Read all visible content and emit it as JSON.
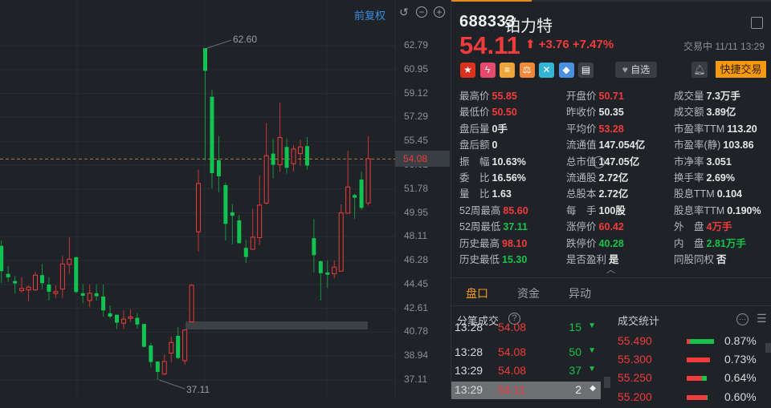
{
  "chart": {
    "toolbar": {
      "adjust_label": "前复权",
      "undo_icon": "undo-icon",
      "zoom_out_icon": "minus-circle-icon",
      "zoom_in_icon": "plus-circle-icon"
    },
    "current_price_label": "54.08",
    "high_marker": "62.60",
    "low_marker": "37.11"
  },
  "chart_data": {
    "type": "candlestick",
    "y_ticks": [
      "62.79",
      "60.95",
      "59.12",
      "57.29",
      "55.45",
      "53.62",
      "51.78",
      "49.95",
      "48.11",
      "46.28",
      "44.45",
      "42.61",
      "40.78",
      "38.94",
      "37.11"
    ],
    "ylim": [
      37.11,
      62.79
    ],
    "current_price": 54.08,
    "up_color": "#f03c3c",
    "down_color": "#11c452",
    "candles": [
      [
        47.42,
        45.47,
        47.83,
        44.55
      ],
      [
        45.26,
        45.0,
        45.88,
        44.65
      ],
      [
        44.71,
        44.53,
        45.1,
        43.73
      ],
      [
        43.97,
        44.14,
        45.0,
        43.83
      ],
      [
        44.03,
        44.24,
        44.38,
        43.17
      ],
      [
        44.03,
        45.16,
        45.43,
        43.97
      ],
      [
        45.16,
        44.55,
        46.02,
        44.09
      ],
      [
        44.44,
        43.89,
        45.0,
        43.21
      ],
      [
        43.75,
        43.89,
        44.38,
        43.42
      ],
      [
        44.09,
        46.02,
        46.64,
        43.42
      ],
      [
        45.98,
        46.39,
        48.08,
        45.26
      ],
      [
        46.54,
        43.87,
        46.6,
        43.77
      ],
      [
        43.77,
        43.58,
        44.48,
        43.01
      ],
      [
        43.21,
        43.77,
        44.44,
        42.7
      ],
      [
        43.77,
        43.54,
        44.44,
        43.21
      ],
      [
        43.52,
        42.45,
        44.44,
        41.98
      ],
      [
        42.23,
        41.98,
        42.84,
        41.84
      ],
      [
        42.12,
        41.51,
        42.12,
        41.02
      ],
      [
        41.47,
        41.78,
        42.45,
        41.02
      ],
      [
        41.84,
        41.96,
        42.54,
        41.57
      ],
      [
        41.88,
        41.37,
        42.23,
        41.06
      ],
      [
        41.41,
        39.66,
        41.41,
        39.62
      ],
      [
        39.76,
        38.49,
        39.97,
        38.08
      ],
      [
        38.53,
        37.73,
        38.53,
        37.11
      ],
      [
        37.57,
        38.53,
        39.07,
        37.47
      ],
      [
        39.17,
        39.99,
        40.44,
        38.49
      ],
      [
        40.5,
        38.8,
        41.16,
        38.7
      ],
      [
        38.59,
        40.95,
        40.95,
        38.29
      ],
      [
        41.57,
        44.38,
        44.48,
        41.53
      ],
      [
        48.49,
        52.2,
        53.27,
        46.97
      ],
      [
        62.6,
        60.86,
        62.6,
        53.99
      ],
      [
        58.87,
        53.0,
        59.43,
        51.83
      ],
      [
        53.99,
        52.76,
        55.84,
        51.53
      ],
      [
        52.08,
        49.1,
        52.28,
        47.83
      ],
      [
        49.99,
        49.72,
        50.64,
        47.52
      ],
      [
        49.37,
        47.62,
        49.78,
        47.58
      ],
      [
        47.26,
        46.56,
        47.87,
        46.09
      ],
      [
        47.15,
        48.08,
        50.25,
        47.11
      ],
      [
        48.04,
        50.54,
        52.8,
        47.46
      ],
      [
        50.7,
        54.34,
        56.86,
        50.6
      ],
      [
        54.5,
        53.64,
        55.63,
        52.59
      ],
      [
        53.64,
        55.73,
        58.4,
        53.11
      ],
      [
        55.01,
        53.41,
        55.67,
        52.96
      ],
      [
        53.72,
        54.85,
        55.16,
        53.13
      ],
      [
        54.5,
        55.01,
        55.57,
        53.58
      ],
      [
        55.08,
        53.58,
        55.77,
        53.27
      ],
      [
        48.0,
        46.7,
        49.47,
        45.37
      ],
      [
        46.23,
        45.31,
        46.29,
        43.21
      ],
      [
        45.37,
        45.2,
        46.29,
        44.18
      ],
      [
        45.26,
        45.78,
        46.29,
        44.92
      ],
      [
        45.47,
        49.94,
        50.6,
        45.43
      ],
      [
        49.92,
        51.94,
        54.71,
        49.88
      ],
      [
        51.32,
        51.11,
        51.42,
        49.47
      ],
      [
        52.51,
        50.33,
        53.13,
        50.19
      ],
      [
        50.71,
        54.11,
        55.85,
        50.5
      ]
    ]
  },
  "quote": {
    "code": "688333",
    "name": "铂力特",
    "price": "54.11",
    "change": "+3.76",
    "change_pct": "+7.47%",
    "status": "交易中 11/11 13:29",
    "fav_label": "自选",
    "quick_trade_label": "快捷交易",
    "tag_icons": [
      {
        "name": "china-flag-icon",
        "glyph": "★",
        "color": "#d8321f"
      },
      {
        "name": "margin-trading-icon",
        "glyph": "ϟ",
        "color": "#e84a6b"
      },
      {
        "name": "coins-icon",
        "glyph": "≡",
        "color": "#eea63a"
      },
      {
        "name": "scale-icon",
        "glyph": "⚖",
        "color": "#f08a3a"
      },
      {
        "name": "shuffle-icon",
        "glyph": "✕",
        "color": "#33b6d6"
      },
      {
        "name": "tag-icon",
        "glyph": "◆",
        "color": "#4a8fe0"
      },
      {
        "name": "notes-icon",
        "glyph": "▤",
        "color": "#3e4248"
      }
    ]
  },
  "stats": [
    [
      {
        "label": "最高价",
        "value": "55.85",
        "color": "#f03c3c"
      },
      {
        "label": "最低价",
        "value": "50.50",
        "color": "#f03c3c"
      },
      {
        "label": "盘后量",
        "value": "0手",
        "color": "#e6e6e6"
      },
      {
        "label": "盘后额",
        "value": "0",
        "color": "#e6e6e6"
      },
      {
        "label": "振　幅",
        "value": "10.63%",
        "color": "#e6e6e6"
      },
      {
        "label": "委　比",
        "value": "16.56%",
        "color": "#e6e6e6"
      },
      {
        "label": "量　比",
        "value": "1.63",
        "color": "#e6e6e6"
      },
      {
        "label": "52周最高",
        "value": "85.60",
        "color": "#f03c3c"
      },
      {
        "label": "52周最低",
        "value": "37.11",
        "color": "#17c24a"
      },
      {
        "label": "历史最高",
        "value": "98.10",
        "color": "#f03c3c"
      },
      {
        "label": "历史最低",
        "value": "15.30",
        "color": "#17c24a"
      }
    ],
    [
      {
        "label": "开盘价",
        "value": "50.71",
        "color": "#f03c3c"
      },
      {
        "label": "昨收价",
        "value": "50.35",
        "color": "#e6e6e6"
      },
      {
        "label": "平均价",
        "value": "53.28",
        "color": "#f03c3c"
      },
      {
        "label": "流通值",
        "value": "147.054亿",
        "color": "#e6e6e6"
      },
      {
        "label": "总市值",
        "value": "147.05亿",
        "color": "#e6e6e6"
      },
      {
        "label": "流通股",
        "value": "2.72亿",
        "color": "#e6e6e6"
      },
      {
        "label": "总股本",
        "value": "2.72亿",
        "color": "#e6e6e6"
      },
      {
        "label": "每　手",
        "value": "100股",
        "color": "#e6e6e6"
      },
      {
        "label": "涨停价",
        "value": "60.42",
        "color": "#f03c3c"
      },
      {
        "label": "跌停价",
        "value": "40.28",
        "color": "#17c24a"
      },
      {
        "label": "是否盈利",
        "value": "是",
        "color": "#e6e6e6"
      }
    ],
    [
      {
        "label": "成交量",
        "value": "7.3万手",
        "color": "#e6e6e6"
      },
      {
        "label": "成交额",
        "value": "3.89亿",
        "color": "#e6e6e6"
      },
      {
        "label": "市盈率TTM",
        "value": "113.20",
        "color": "#e6e6e6"
      },
      {
        "label": "市盈率(静)",
        "value": "103.86",
        "color": "#e6e6e6"
      },
      {
        "label": "市净率",
        "value": "3.051",
        "color": "#e6e6e6"
      },
      {
        "label": "换手率",
        "value": "2.69%",
        "color": "#e6e6e6"
      },
      {
        "label": "股息TTM",
        "value": "0.104",
        "color": "#e6e6e6"
      },
      {
        "label": "股息率TTM",
        "value": "0.190%",
        "color": "#e6e6e6"
      },
      {
        "label": "外　盘",
        "value": "4万手",
        "color": "#f03c3c"
      },
      {
        "label": "内　盘",
        "value": "2.81万手",
        "color": "#17c24a"
      },
      {
        "label": "同股同权",
        "value": "否",
        "color": "#e6e6e6"
      }
    ]
  ],
  "tabs": [
    {
      "label": "盘口",
      "active": true
    },
    {
      "label": "资金",
      "active": false
    },
    {
      "label": "异动",
      "active": false
    }
  ],
  "ticks": {
    "title": "分笔成交",
    "rows": [
      {
        "time": "13:28",
        "price": "54.08",
        "vol": "15",
        "dir": "down"
      },
      {
        "time": "13:28",
        "price": "54.08",
        "vol": "50",
        "dir": "down"
      },
      {
        "time": "13:29",
        "price": "54.08",
        "vol": "37",
        "dir": "down"
      },
      {
        "time": "13:29",
        "price": "54.11",
        "vol": "2",
        "dir": "neutral"
      }
    ]
  },
  "volume_stats": {
    "title": "成交统计",
    "rows": [
      {
        "price": "55.490",
        "pct": "0.87%",
        "buy_ratio": 0.12
      },
      {
        "price": "55.300",
        "pct": "0.73%",
        "buy_ratio": 1.0
      },
      {
        "price": "55.250",
        "pct": "0.64%",
        "buy_ratio": 0.75
      },
      {
        "price": "55.200",
        "pct": "0.60%",
        "buy_ratio": 0.95
      }
    ]
  }
}
